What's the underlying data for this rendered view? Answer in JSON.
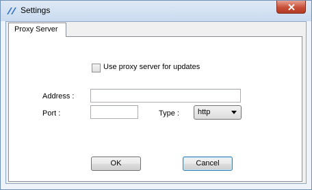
{
  "window": {
    "title": "Settings",
    "close_symbol": "✕"
  },
  "tabs": [
    {
      "label": "Proxy Server",
      "active": true
    }
  ],
  "proxy": {
    "use_proxy_label": "Use proxy server for updates",
    "use_proxy_checked": false,
    "address_label": "Address :",
    "address_value": "",
    "port_label": "Port :",
    "port_value": "",
    "type_label": "Type :",
    "type_value": "http"
  },
  "buttons": {
    "ok_label": "OK",
    "cancel_label": "Cancel"
  },
  "icons": {
    "app": "app-logo-icon",
    "close": "close-icon",
    "dropdown": "chevron-down-icon"
  },
  "colors": {
    "title_bar": "#c9dbef",
    "close_button": "#c75039",
    "dialog_face": "#f0f0f0",
    "default_button_border": "#3c7fb1"
  }
}
